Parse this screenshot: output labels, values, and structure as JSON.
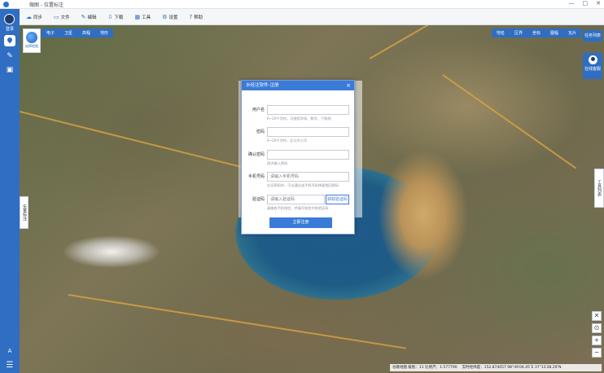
{
  "window": {
    "title": "微图 - 位置标注",
    "controls": [
      "—",
      "□",
      "✕"
    ]
  },
  "sidebar": {
    "login_label": "登录",
    "icons": [
      "user-avatar-icon",
      "location-pin-icon",
      "pen-icon",
      "image-icon",
      "font-icon",
      "menu-icon"
    ],
    "bottom_font": "A",
    "bottom_menu": "☰"
  },
  "toolbar": {
    "items": [
      {
        "icon": "☁",
        "label": "同步"
      },
      {
        "icon": "▭",
        "label": "文件"
      },
      {
        "icon": "✎",
        "label": "编辑"
      },
      {
        "icon": "⇩",
        "label": "下载"
      },
      {
        "icon": "▦",
        "label": "工具"
      },
      {
        "icon": "⚙",
        "label": "设置"
      },
      {
        "icon": "?",
        "label": "帮助"
      }
    ]
  },
  "map": {
    "logo_label": "选择地图",
    "basemap_tabs": [
      "电子",
      "卫星",
      "高程",
      "地形"
    ],
    "layer_tabs": [
      "地名",
      "区界",
      "坐标",
      "图幅",
      "瓦片"
    ],
    "task_button": "任务列表",
    "service_button": "在线客服",
    "toolbox_tab": "工具列表",
    "left_handle": "矢量标注",
    "zoom_controls": [
      "✕",
      "⊙",
      "+",
      "−"
    ],
    "status": {
      "source": "谷歌地图 级别：11 比例尺：1:577790",
      "coords": "实时经纬度：152.874057   98°49′04.45″E   37°13′28.29″N"
    }
  },
  "dialog": {
    "title": "水经注软件-注册",
    "close": "×",
    "fields": [
      {
        "label": "用户名",
        "value": "",
        "placeholder": "",
        "hint": "6~20个字符，可使用字母、数字、下划线"
      },
      {
        "label": "密码",
        "value": "",
        "placeholder": "",
        "hint": "6~20个字符，区分大小写"
      },
      {
        "label": "确认密码",
        "value": "",
        "placeholder": "",
        "hint": "再次输入密码"
      },
      {
        "label": "手机号码",
        "value": "",
        "placeholder": "请输入手机号码",
        "hint": "忘记密码时，可以通过该手机号码快速找回密码"
      },
      {
        "label": "验证码",
        "value": "",
        "placeholder": "请输入验证码",
        "hint": "请查收手机短信，并填写短信中的验证码"
      }
    ],
    "get_code_label": "获取验证码",
    "submit_label": "立即注册"
  }
}
